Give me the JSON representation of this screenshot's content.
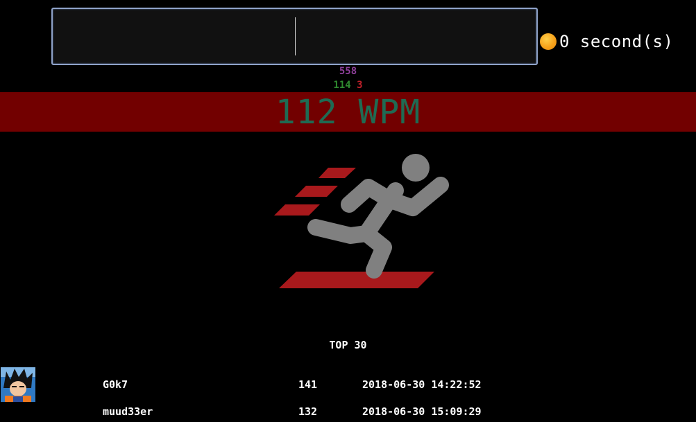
{
  "timer": {
    "value": "0 second(s)"
  },
  "stats": {
    "total": "558",
    "correct": "114",
    "wrong": "3"
  },
  "result": {
    "wpm": "112 WPM"
  },
  "leaderboard": {
    "title": "TOP 30",
    "rows": [
      {
        "name": "G0k7",
        "score": "141",
        "date": "2018-06-30 14:22:52"
      },
      {
        "name": "muud33er",
        "score": "132",
        "date": "2018-06-30 15:09:29"
      }
    ]
  },
  "colors": {
    "background": "#000000",
    "wpm_bar": "#720000",
    "wpm_text": "#1f6b53",
    "correct": "#2f8a2f",
    "wrong": "#c0202a",
    "total": "#8e3f9a",
    "runner_figure": "#808080",
    "runner_stripes": "#a8191c"
  }
}
